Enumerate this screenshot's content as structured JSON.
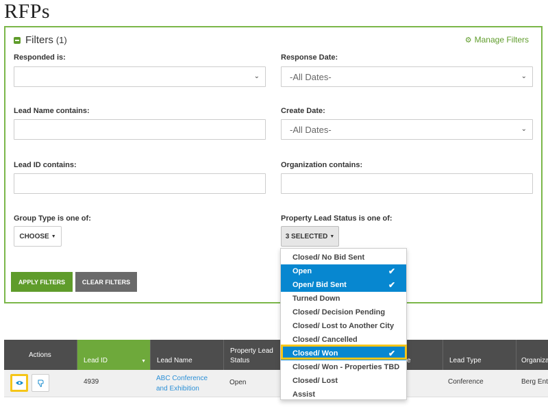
{
  "page": {
    "title": "RFPs"
  },
  "filters": {
    "title": "Filters",
    "count": "(1)",
    "manage_label": "Manage Filters",
    "responded": {
      "label": "Responded is:",
      "value": ""
    },
    "response_date": {
      "label": "Response Date:",
      "value": "-All Dates-"
    },
    "lead_name": {
      "label": "Lead Name contains:",
      "value": ""
    },
    "create_date": {
      "label": "Create Date:",
      "value": "-All Dates-"
    },
    "lead_id": {
      "label": "Lead ID contains:",
      "value": ""
    },
    "organization": {
      "label": "Organization contains:",
      "value": ""
    },
    "group_type": {
      "label": "Group Type is one of:",
      "button": "CHOOSE"
    },
    "property_status": {
      "label": "Property Lead Status is one of:",
      "button": "3 SELECTED",
      "options": [
        {
          "label": "Closed/ No Bid Sent",
          "selected": false
        },
        {
          "label": "Open",
          "selected": true
        },
        {
          "label": "Open/ Bid Sent",
          "selected": true
        },
        {
          "label": "Turned Down",
          "selected": false
        },
        {
          "label": "Closed/ Decision Pending",
          "selected": false
        },
        {
          "label": "Closed/ Lost to Another City",
          "selected": false
        },
        {
          "label": "Closed/ Cancelled",
          "selected": false
        },
        {
          "label": "Closed/ Won",
          "selected": true
        },
        {
          "label": "Closed/ Won - Properties TBD",
          "selected": false
        },
        {
          "label": "Closed/ Lost",
          "selected": false
        },
        {
          "label": "Assist",
          "selected": false
        }
      ]
    },
    "apply_label": "APPLY FILTERS",
    "clear_label": "CLEAR FILTERS"
  },
  "table": {
    "headers": {
      "actions": "Actions",
      "lead_id": "Lead ID",
      "lead_name": "Lead Name",
      "status_line1": "Property Lead",
      "status_line2": "Status",
      "partial": "e",
      "lead_type": "Lead Type",
      "organization": "Organiza"
    },
    "row": {
      "lead_id": "4939",
      "lead_name_line1": "ABC Conference",
      "lead_name_line2": "and Exhibition",
      "status": "Open",
      "lead_type": "Conference",
      "organization": "Berg Ent"
    }
  },
  "colors": {
    "accent_green": "#5f9c2b",
    "selected_blue": "#0787d0",
    "highlight_yellow": "#f5c518",
    "header_dark": "#4d4d4d"
  }
}
